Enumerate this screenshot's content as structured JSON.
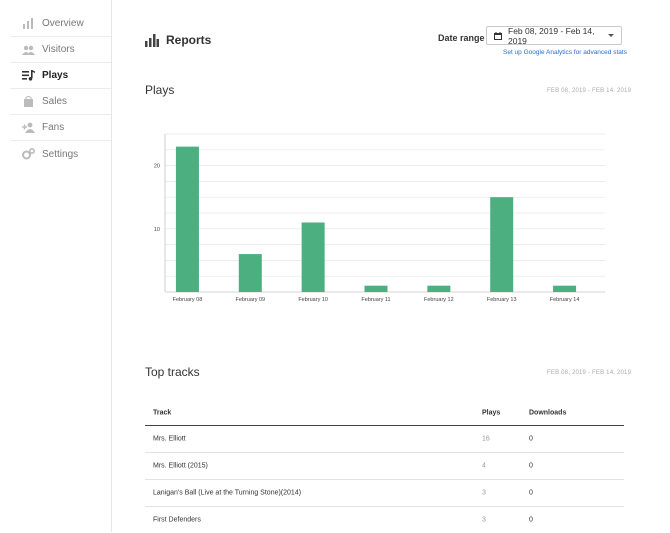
{
  "sidebar": {
    "items": [
      {
        "label": "Overview",
        "icon": "bar-chart-icon",
        "active": false
      },
      {
        "label": "Visitors",
        "icon": "people-icon",
        "active": false
      },
      {
        "label": "Plays",
        "icon": "playlist-music-icon",
        "active": true
      },
      {
        "label": "Sales",
        "icon": "shopping-bag-icon",
        "active": false
      },
      {
        "label": "Fans",
        "icon": "add-person-icon",
        "active": false
      },
      {
        "label": "Settings",
        "icon": "gears-icon",
        "active": false
      }
    ]
  },
  "header": {
    "title": "Reports",
    "date_range_label": "Date range",
    "date_range_value": "Feb 08, 2019 - Feb 14, 2019",
    "ga_link": "Set up Google Analytics for advanced stats"
  },
  "plays": {
    "title": "Plays",
    "date": "FEB 08, 2019 - FEB 14, 2019"
  },
  "chart_data": {
    "type": "bar",
    "categories": [
      "February 08",
      "February 09",
      "February 10",
      "February 11",
      "February 12",
      "February 13",
      "February 14"
    ],
    "values": [
      23,
      6,
      11,
      1,
      1,
      15,
      1
    ],
    "yticks": [
      10,
      20
    ],
    "ylim": [
      0,
      25
    ],
    "grid": true,
    "color": "#4caf80"
  },
  "top_tracks": {
    "title": "Top tracks",
    "date": "FEB 08, 2019 - FEB 14, 2019",
    "columns": {
      "track": "Track",
      "plays": "Plays",
      "downloads": "Downloads"
    },
    "rows": [
      {
        "track": "Mrs. Elliott",
        "plays": "16",
        "downloads": "0"
      },
      {
        "track": "Mrs. Elliott (2015)",
        "plays": "4",
        "downloads": "0"
      },
      {
        "track": "Lanigan's Ball (Live at the Turning Stone)(2014)",
        "plays": "3",
        "downloads": "0"
      },
      {
        "track": "First Defenders",
        "plays": "3",
        "downloads": "0"
      }
    ]
  }
}
